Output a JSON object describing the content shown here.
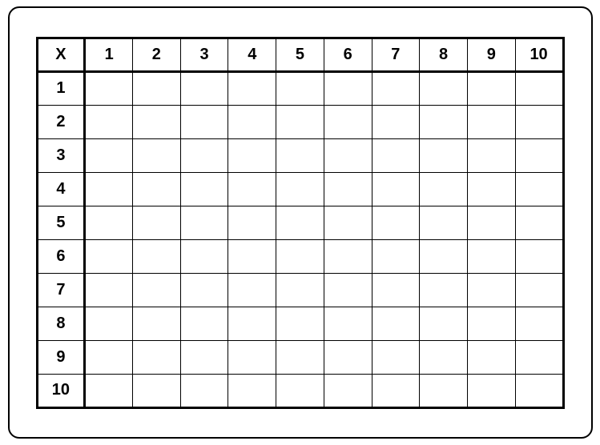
{
  "table": {
    "corner_label": "X",
    "column_headers": [
      "1",
      "2",
      "3",
      "4",
      "5",
      "6",
      "7",
      "8",
      "9",
      "10"
    ],
    "row_headers": [
      "1",
      "2",
      "3",
      "4",
      "5",
      "6",
      "7",
      "8",
      "9",
      "10"
    ],
    "cells": [
      [
        "",
        "",
        "",
        "",
        "",
        "",
        "",
        "",
        "",
        ""
      ],
      [
        "",
        "",
        "",
        "",
        "",
        "",
        "",
        "",
        "",
        ""
      ],
      [
        "",
        "",
        "",
        "",
        "",
        "",
        "",
        "",
        "",
        ""
      ],
      [
        "",
        "",
        "",
        "",
        "",
        "",
        "",
        "",
        "",
        ""
      ],
      [
        "",
        "",
        "",
        "",
        "",
        "",
        "",
        "",
        "",
        ""
      ],
      [
        "",
        "",
        "",
        "",
        "",
        "",
        "",
        "",
        "",
        ""
      ],
      [
        "",
        "",
        "",
        "",
        "",
        "",
        "",
        "",
        "",
        ""
      ],
      [
        "",
        "",
        "",
        "",
        "",
        "",
        "",
        "",
        "",
        ""
      ],
      [
        "",
        "",
        "",
        "",
        "",
        "",
        "",
        "",
        "",
        ""
      ],
      [
        "",
        "",
        "",
        "",
        "",
        "",
        "",
        "",
        "",
        ""
      ]
    ]
  }
}
